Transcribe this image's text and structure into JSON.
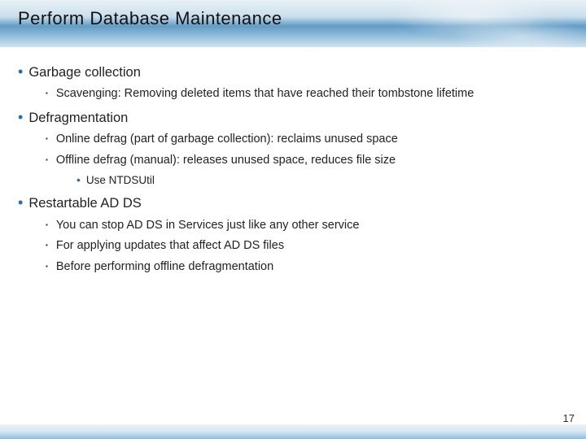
{
  "title": "Perform Database Maintenance",
  "page_number": "17",
  "sections": [
    {
      "heading": "Garbage collection",
      "items": [
        {
          "text": "Scavenging: Removing deleted items that have reached their tombstone lifetime"
        }
      ]
    },
    {
      "heading": "Defragmentation",
      "items": [
        {
          "text": "Online defrag (part of garbage collection): reclaims unused space"
        },
        {
          "text": "Offline defrag (manual): releases unused space, reduces file size",
          "sub": [
            "Use NTDSUtil"
          ]
        }
      ]
    },
    {
      "heading": "Restartable AD DS",
      "items": [
        {
          "text": "You can stop AD DS in Services just like any other service"
        },
        {
          "text": "For applying updates that affect AD DS files"
        },
        {
          "text": "Before performing offline defragmentation"
        }
      ]
    }
  ]
}
